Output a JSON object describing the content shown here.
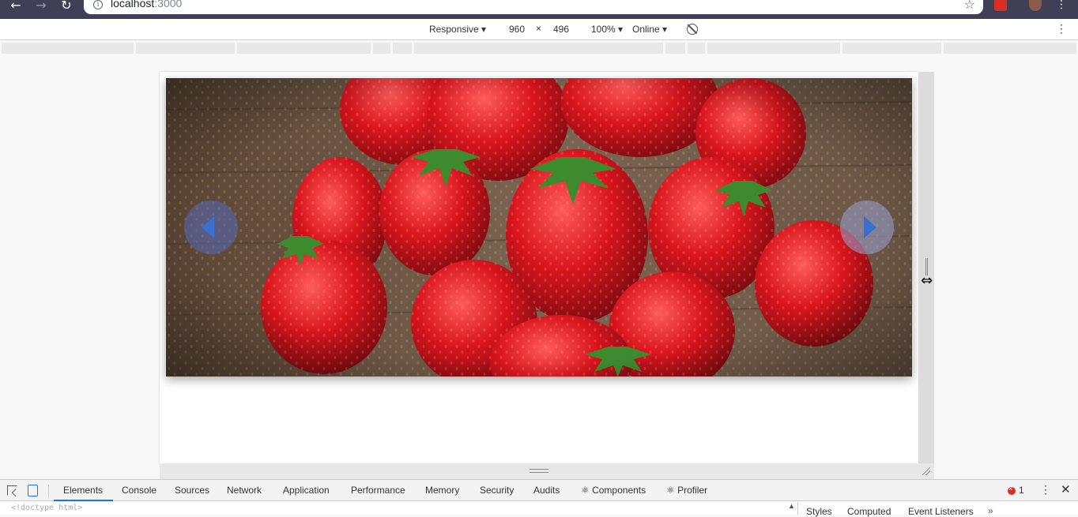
{
  "browser": {
    "back_glyph": "←",
    "forward_glyph": "→",
    "reload_glyph": "↻",
    "url_host": "localhost",
    "url_port": ":3000",
    "star_glyph": "☆",
    "menu_glyph": "⋮"
  },
  "device_toolbar": {
    "mode": "Responsive",
    "width": "960",
    "times": "×",
    "height": "496",
    "zoom": "100%",
    "network": "Online",
    "menu_glyph": "⋮"
  },
  "carousel": {
    "prev_icon": "chevron-left-icon",
    "next_icon": "chevron-right-icon",
    "image_subject": "strawberries on wooden table"
  },
  "devtools": {
    "tabs": [
      "Elements",
      "Console",
      "Sources",
      "Network",
      "Application",
      "Performance",
      "Memory",
      "Security",
      "Audits",
      "⚛ Components",
      "⚛ Profiler"
    ],
    "error_count": "1",
    "menu_glyph": "⋮",
    "close_glyph": "✕",
    "doctype": "<!doctype html>",
    "side_tabs": [
      "Styles",
      "Computed",
      "Event Listeners"
    ],
    "more_glyph": "»"
  },
  "colors": {
    "chrome_bg": "#3f3f55",
    "accent": "#1a73e8",
    "error": "#d93025",
    "carousel_arrow": "#3a6fd0"
  }
}
